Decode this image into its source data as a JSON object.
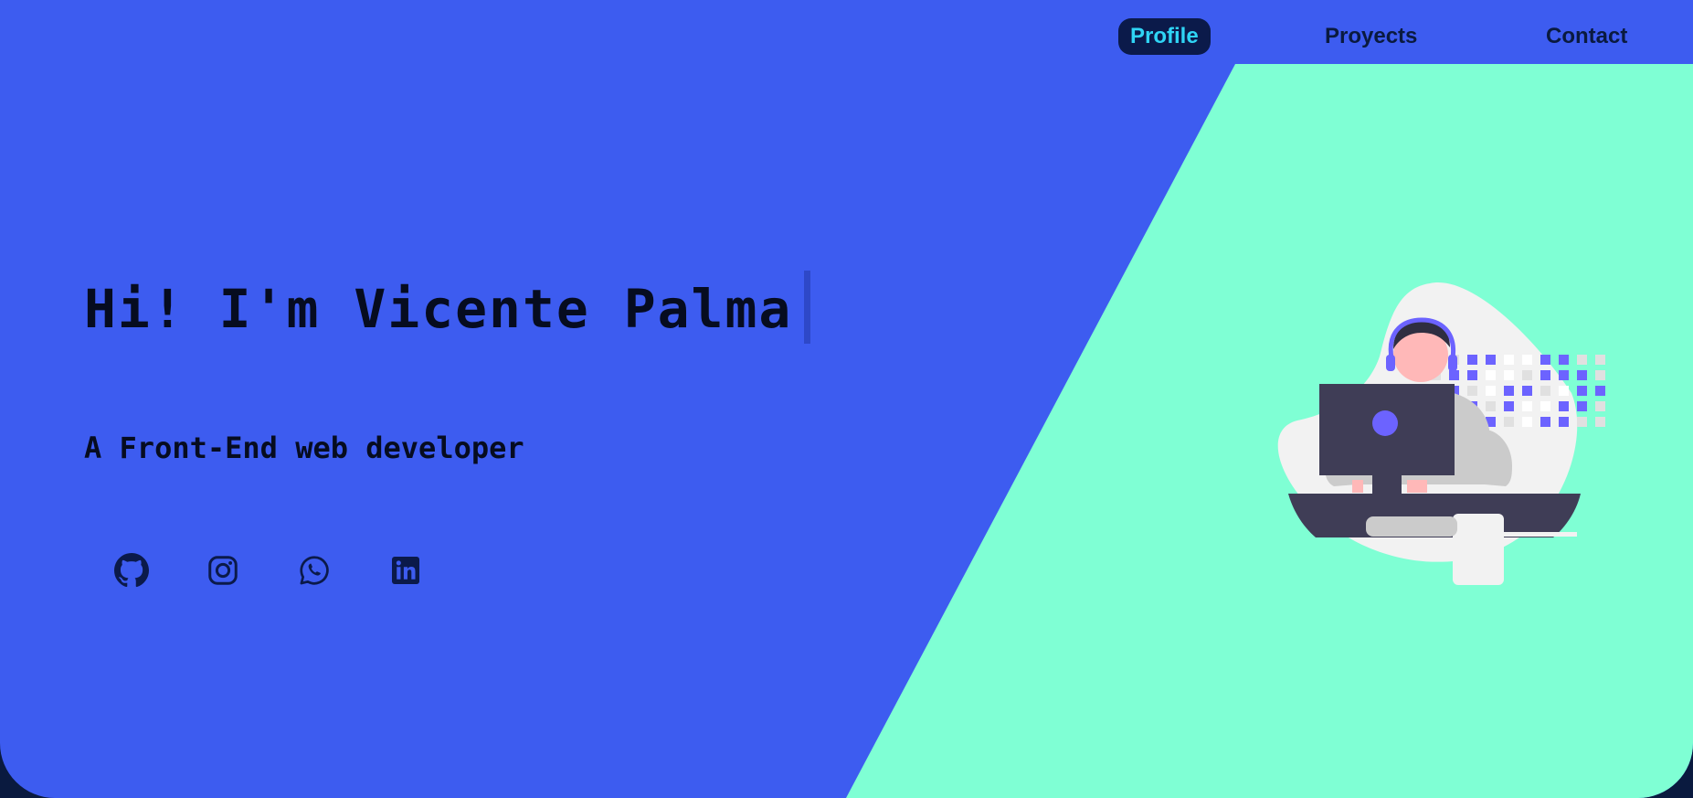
{
  "nav": {
    "items": [
      {
        "label": "Profile",
        "active": true
      },
      {
        "label": "Proyects",
        "active": false
      },
      {
        "label": "Contact",
        "active": false
      }
    ]
  },
  "hero": {
    "title": "Hi! I'm Vicente Palma",
    "subtitle": "A Front-End web developer"
  },
  "socials": [
    {
      "icon": "github-icon"
    },
    {
      "icon": "instagram-icon"
    },
    {
      "icon": "whatsapp-icon"
    },
    {
      "icon": "linkedin-icon"
    }
  ],
  "colors": {
    "hero_background": "#3d5cf0",
    "mint_panel": "#7fffd4",
    "nav_active_bg": "#0b1a4a",
    "nav_active_text": "#2fd4f5",
    "text_dark": "#060c20",
    "page_background": "#0a1a3f",
    "illustration_accent": "#6c63ff"
  }
}
